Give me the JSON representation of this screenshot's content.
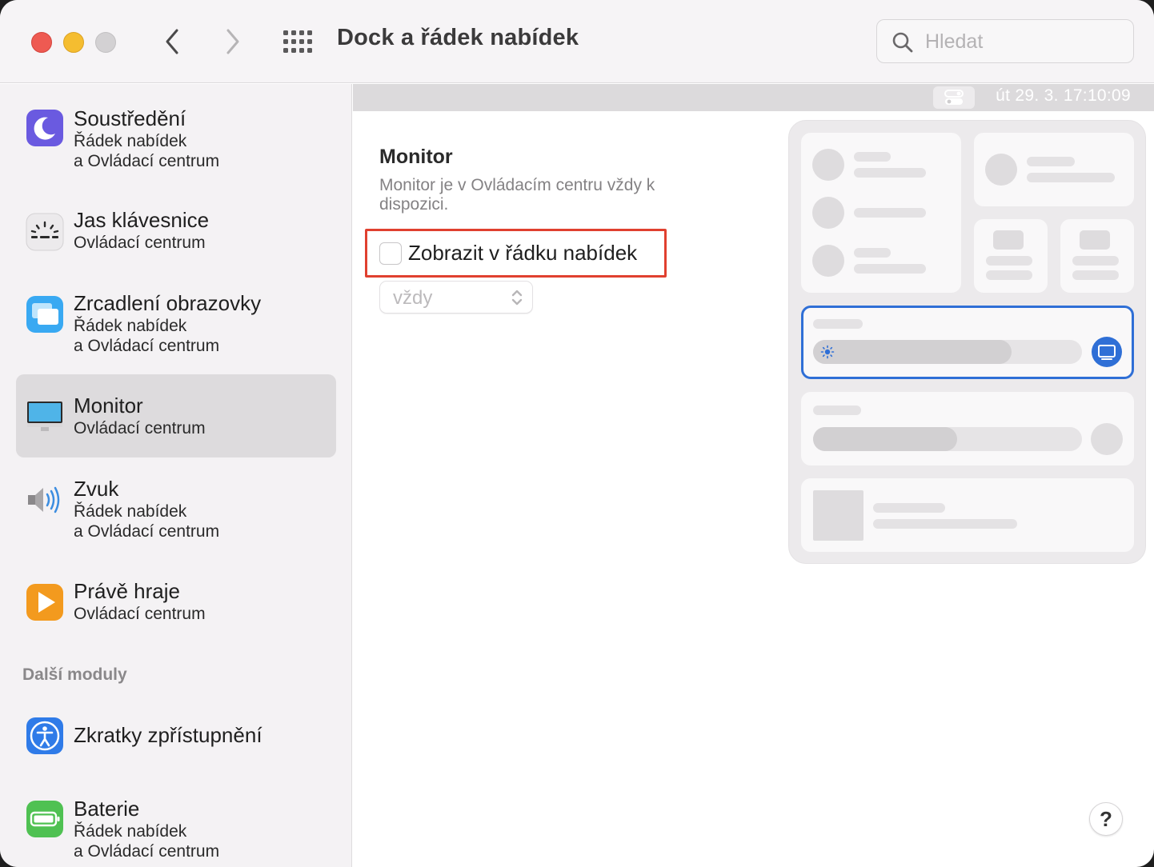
{
  "window": {
    "title": "Dock a řádek nabídek"
  },
  "search": {
    "placeholder": "Hledat"
  },
  "sidebar": {
    "items": [
      {
        "title": "Soustředění",
        "sub1": "Řádek nabídek",
        "sub2": "a Ovládací centrum",
        "icon": "moon-icon"
      },
      {
        "title": "Jas klávesnice",
        "sub1": "Ovládací centrum",
        "icon": "keyboard-brightness-icon"
      },
      {
        "title": "Zrcadlení obrazovky",
        "sub1": "Řádek nabídek",
        "sub2": "a Ovládací centrum",
        "icon": "screen-mirroring-icon"
      },
      {
        "title": "Monitor",
        "sub1": "Ovládací centrum",
        "icon": "display-icon",
        "selected": true
      },
      {
        "title": "Zvuk",
        "sub1": "Řádek nabídek",
        "sub2": "a Ovládací centrum",
        "icon": "speaker-icon"
      },
      {
        "title": "Právě hraje",
        "sub1": "Ovládací centrum",
        "icon": "now-playing-icon"
      },
      {
        "title": "Zkratky zpřístupnění",
        "icon": "accessibility-icon"
      },
      {
        "title": "Baterie",
        "sub1": "Řádek nabídek",
        "sub2": "a Ovládací centrum",
        "icon": "battery-icon"
      }
    ],
    "section_header": "Další moduly"
  },
  "menubar_preview": {
    "clock": "út 29. 3.  17:10:09"
  },
  "detail": {
    "title": "Monitor",
    "description": "Monitor je v Ovládacím centru vždy k dispozici.",
    "checkbox_label": "Zobrazit v řádku nabídek",
    "checkbox_checked": false,
    "popup_value": "vždy"
  },
  "help": {
    "label": "?"
  },
  "colors": {
    "highlight": "#e0402f",
    "accent": "#2f6fd6",
    "selected_row": "#dddbdd"
  }
}
